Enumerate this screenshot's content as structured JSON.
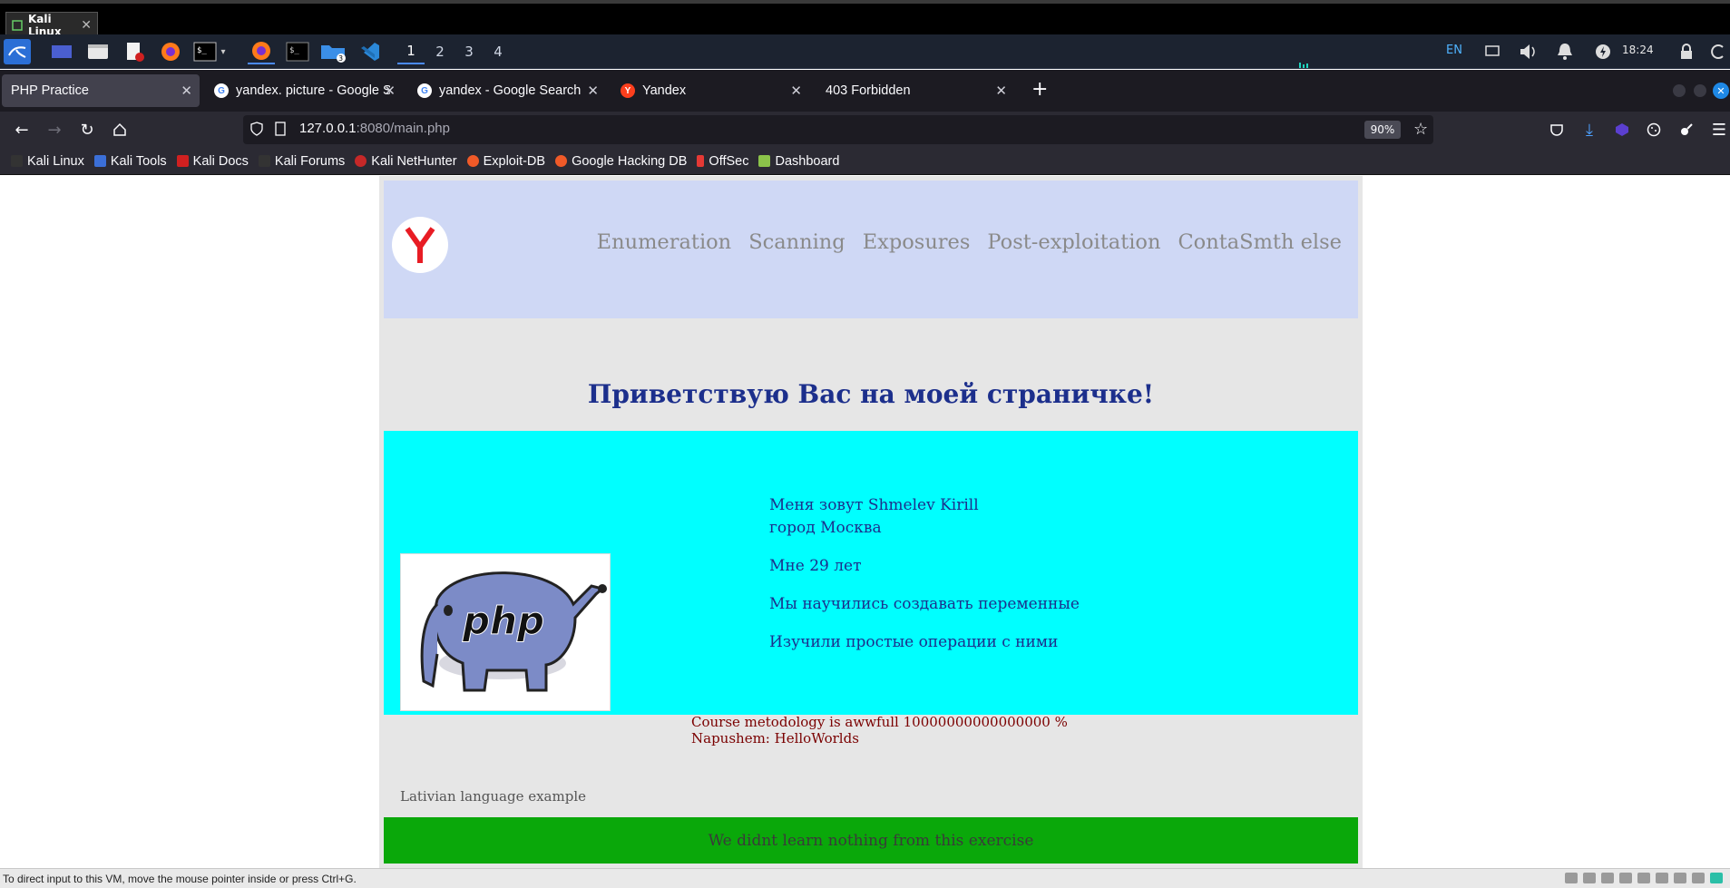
{
  "vm": {
    "tab_title": "Kali Linux",
    "status_message": "To direct input to this VM, move the mouse pointer inside or press Ctrl+G."
  },
  "panel": {
    "workspaces": [
      "1",
      "2",
      "3",
      "4"
    ],
    "files_badge": "3",
    "language": "EN",
    "clock": "18:24"
  },
  "browser": {
    "tabs": [
      {
        "title": "PHP Practice",
        "active": true
      },
      {
        "title": "yandex. picture - Google S",
        "active": false
      },
      {
        "title": "yandex - Google Search",
        "active": false
      },
      {
        "title": "Yandex",
        "active": false
      },
      {
        "title": "403 Forbidden",
        "active": false
      }
    ],
    "url_host": "127.0.0.1",
    "url_rest": ":8080/main.php",
    "zoom": "90%",
    "bookmarks": [
      "Kali Linux",
      "Kali Tools",
      "Kali Docs",
      "Kali Forums",
      "Kali NetHunter",
      "Exploit-DB",
      "Google Hacking DB",
      "OffSec",
      "Dashboard"
    ]
  },
  "site": {
    "nav": [
      "Enumeration",
      "Scanning",
      "Exposures",
      "Post-exploitation",
      "ContaSmth else"
    ],
    "welcome": "Приветствую Вас на моей страничке!",
    "name_line": "Меня зовут Shmelev Kirill",
    "city_line": "город Москва",
    "age_line": "Мне 29 лет",
    "line_variables": "Мы научились создавать переменные",
    "line_operations": "Изучили простые операции с ними",
    "image_text": "php",
    "course_line": "Course metodology is awwfull 10000000000000000 %",
    "napushem_line": "Napushem: HelloWorlds",
    "latvian_label": "Lativian language example",
    "footer_text": "We didnt learn nothing from this exercise"
  },
  "colors": {
    "header_bg": "#cfd8f5",
    "about_bg": "#00ffff",
    "footer_bg": "#0aa80a",
    "title_color": "#1c2f8c",
    "course_color": "#7a0000"
  }
}
